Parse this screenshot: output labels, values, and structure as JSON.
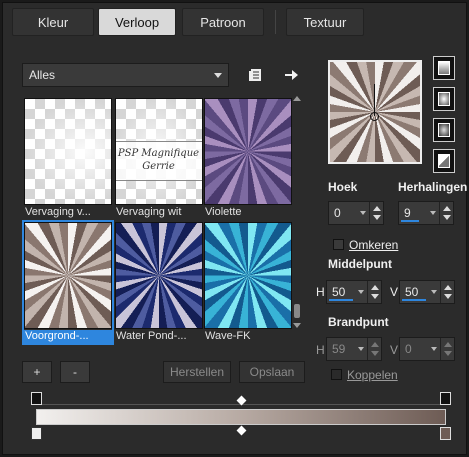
{
  "tabs": [
    {
      "label": "Kleur",
      "active": false
    },
    {
      "label": "Verloop",
      "active": true
    },
    {
      "label": "Patroon",
      "active": false
    },
    {
      "label": "Textuur",
      "active": false
    }
  ],
  "category": {
    "selected": "Alles"
  },
  "thumbnails": [
    {
      "caption": "Vervaging v...",
      "style": "checker-fade"
    },
    {
      "caption": "Vervaging wit",
      "style": "checker-watermark",
      "watermark_line1": "PSP Magnifique",
      "watermark_line2": "Gerrie"
    },
    {
      "caption": "Violette",
      "style": "violet-rays"
    },
    {
      "caption": "Voorgrond-...",
      "style": "fg-rays",
      "selected": true
    },
    {
      "caption": "Water Pond-...",
      "style": "blue-rays"
    },
    {
      "caption": "Wave-FK",
      "style": "cyan-rays"
    }
  ],
  "buttons": {
    "add": "+",
    "remove": "-",
    "reset": "Herstellen",
    "save": "Opslaan"
  },
  "angle": {
    "label": "Hoek",
    "value": "0"
  },
  "repeats": {
    "label": "Herhalingen",
    "value": "9"
  },
  "invert": {
    "label": "Omkeren",
    "checked": false
  },
  "center": {
    "label": "Middelpunt",
    "h_label": "H",
    "h_value": "50",
    "v_label": "V",
    "v_value": "50"
  },
  "focal": {
    "label": "Brandpunt",
    "h_label": "H",
    "h_value": "59",
    "v_label": "V",
    "v_value": "0"
  },
  "link": {
    "label": "Koppelen",
    "checked": false
  },
  "colors": {
    "accent": "#2e86de",
    "panel": "#2b2b2b",
    "gradient_start": "#f2f0ee",
    "gradient_mid": "#b7aaa3",
    "gradient_end": "#6e5c55"
  },
  "icons": [
    "chevron-down-icon",
    "library-icon",
    "arrow-right-icon",
    "linear-type-icon",
    "radial-type-icon",
    "rectangular-type-icon",
    "sunburst-type-icon"
  ]
}
